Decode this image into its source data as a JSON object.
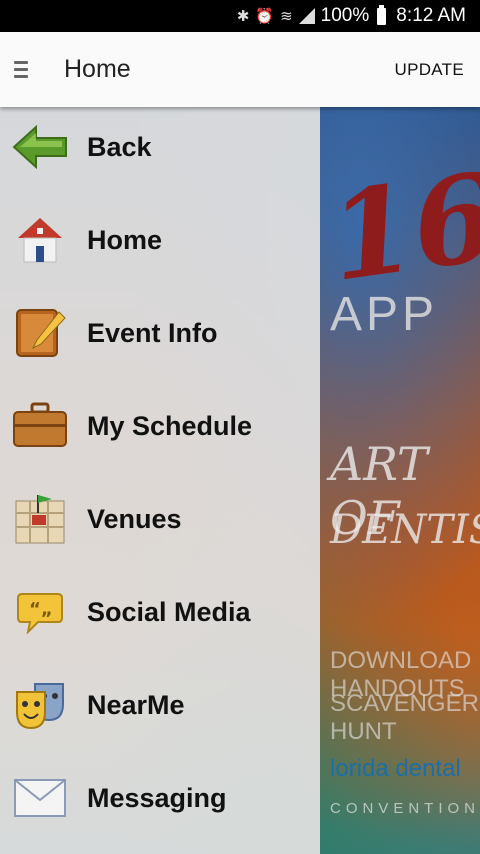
{
  "status_bar": {
    "battery": "100%",
    "time": "8:12 AM"
  },
  "app_bar": {
    "title": "Home",
    "action": "UPDATE"
  },
  "menu": {
    "items": [
      {
        "label": "Back",
        "icon": "back-arrow-icon"
      },
      {
        "label": "Home",
        "icon": "house-icon"
      },
      {
        "label": "Event Info",
        "icon": "notepad-pencil-icon"
      },
      {
        "label": "My Schedule",
        "icon": "briefcase-icon"
      },
      {
        "label": "Venues",
        "icon": "map-icon"
      },
      {
        "label": "Social Media",
        "icon": "speech-bubble-icon"
      },
      {
        "label": "NearMe",
        "icon": "theater-masks-icon"
      },
      {
        "label": "Messaging",
        "icon": "envelope-icon"
      }
    ]
  },
  "poster": {
    "year": "16",
    "mobile_app": "APP",
    "art": "ART OF",
    "dentistry": "DENTISTRY",
    "line1": "DOWNLOAD HANDOUTS",
    "line2": "SCAVENGER HUNT",
    "assoc": "lorida dental",
    "convention": "CONVENTION"
  },
  "colors": {
    "accent_green": "#5a9a2a",
    "drawer_bg": "#e0e0e0"
  }
}
